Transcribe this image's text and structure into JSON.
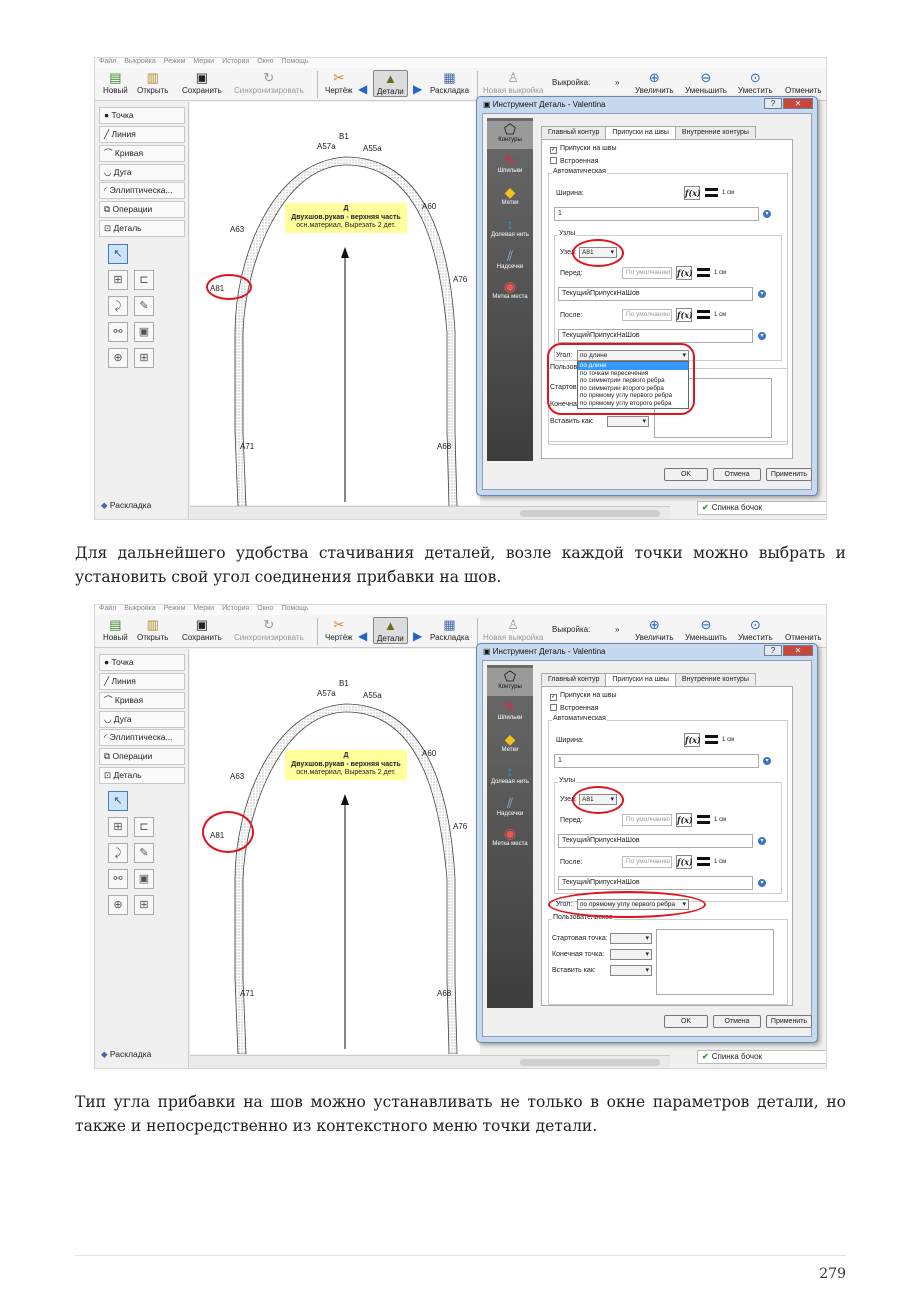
{
  "menu": [
    "Файл",
    "Выкройка",
    "Режим",
    "Мерки",
    "История",
    "Окно",
    "Помощь"
  ],
  "toolbar": {
    "new": "Новый",
    "open": "Открыть",
    "save": "Сохранить",
    "sync": "Синхронизировать",
    "draft": "Чертёж",
    "details": "Детали",
    "layout": "Раскладка",
    "new_pattern": "Новая выкройка",
    "pattern_label": "Выкройка:",
    "zoom_in": "Увеличить",
    "zoom_out": "Уменьшить",
    "fit": "Уместить",
    "cancel": "Отменить"
  },
  "left_panel": {
    "items": [
      "Точка",
      "Линия",
      "Кривая",
      "Дуга",
      "Эллиптическа...",
      "Операции",
      "Деталь"
    ],
    "layout_tab": "Раскладка"
  },
  "canvas": {
    "points": [
      "B1",
      "A57a",
      "A55a",
      "A60",
      "A63",
      "A81",
      "A76",
      "A71",
      "A68"
    ],
    "piece_label": {
      "letter": "Д",
      "name": "Двухшов.рукав - верхняя часть",
      "note": "осн.материал, Вырезать 2 дет."
    }
  },
  "status": {
    "spinka": "Спинка бочок"
  },
  "dialog": {
    "title": "Инструмент Деталь - Valentina",
    "side": [
      "Контуры",
      "Шпильки",
      "Метки",
      "Долевая нить",
      "Надсечки",
      "Метка места"
    ],
    "tabs": [
      "Главный контур",
      "Припуски на швы",
      "Внутренние контуры"
    ],
    "seam_allowance": "Припуски на швы",
    "builtin": "Встроенная",
    "automatic": "Автоматическая",
    "width_label": "Ширина:",
    "width_value": "1",
    "unit": "1 см",
    "nodes_group": "Узлы",
    "node_label": "Узел:",
    "node_value": "A81",
    "before_label": "Перед:",
    "after_label": "После:",
    "default_placeholder": "По умолчанию",
    "current_sa": "ТекущийПрипускНаШов",
    "angle_label": "Угол:",
    "angle_value_1": "по длине",
    "angle_value_2": "по прямому углу первого ребра",
    "custom_group": "Пользовательское",
    "custom_group_cut": "Пользова",
    "start_point": "Стартовая точка:",
    "start_cut": "Стартов",
    "end_point": "Конечная точка:",
    "end_cut": "Конечна",
    "insert_as": "Вставить как:",
    "angle_options": [
      "по длине",
      "по точкам пересечения",
      "по симметрии первого ребра",
      "по симметрии второго ребра",
      "по прямому углу первого ребра",
      "по прямому углу второго ребра"
    ],
    "ok": "OK",
    "cancel": "Отмена",
    "apply": "Применить"
  },
  "paragraph1": "Для дальнейшего удобства стачивания деталей, возле каждой точки можно выбрать и установить свой угол соединения прибавки на шов.",
  "paragraph2": "Тип угла прибавки на шов можно устанавливать не только в окне параметров детали, но также и непосредственно из контекстного меню точки детали.",
  "page_number": "279",
  "colors": {
    "highlight": "#e0141e",
    "selection": "#3399ff",
    "label_bg": "#ffff9c"
  }
}
